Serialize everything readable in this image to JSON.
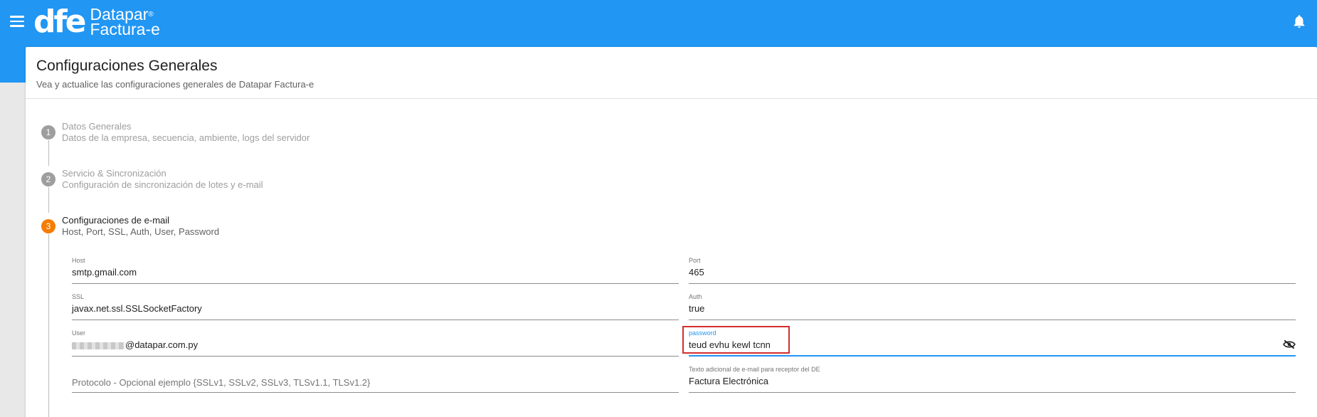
{
  "header": {
    "logo_mark": "dfe",
    "brand_line1": "Datapar",
    "brand_registered": "®",
    "brand_line2": "Factura-e"
  },
  "page": {
    "title": "Configuraciones Generales",
    "subtitle": "Vea y actualice las configuraciones generales de Datapar Factura-e"
  },
  "steps": [
    {
      "number": "1",
      "title": "Datos Generales",
      "description": "Datos de la empresa, secuencia, ambiente, logs del servidor",
      "state": "completed"
    },
    {
      "number": "2",
      "title": "Servicio & Sincronización",
      "description": "Configuración de sincronización de lotes y e-mail",
      "state": "completed"
    },
    {
      "number": "3",
      "title": "Configuraciones de e-mail",
      "description": "Host, Port, SSL, Auth, User, Password",
      "state": "active"
    }
  ],
  "form": {
    "host": {
      "label": "Host",
      "value": "smtp.gmail.com"
    },
    "port": {
      "label": "Port",
      "value": "465"
    },
    "ssl": {
      "label": "SSL",
      "value": "javax.net.ssl.SSLSocketFactory"
    },
    "auth": {
      "label": "Auth",
      "value": "true"
    },
    "user": {
      "label": "User",
      "value": "@datapar.com.py"
    },
    "password": {
      "label": "password",
      "value": "teud evhu kewl tcnn"
    },
    "protocol": {
      "placeholder": "Protocolo - Opcional ejemplo {SSLv1, SSLv2, SSLv3, TLSv1.1, TLSv1.2}"
    },
    "email_text": {
      "label": "Texto adicional de e-mail para receptor del DE",
      "value": "Factura Electrónica"
    }
  },
  "colors": {
    "primary": "#2196f3",
    "active_step": "#f57c00",
    "inactive_step": "#9e9e9e",
    "highlight": "#d32f2f"
  },
  "icons": {
    "menu": "menu-icon",
    "notifications": "bell-icon",
    "password_visibility": "eye-off-icon"
  }
}
